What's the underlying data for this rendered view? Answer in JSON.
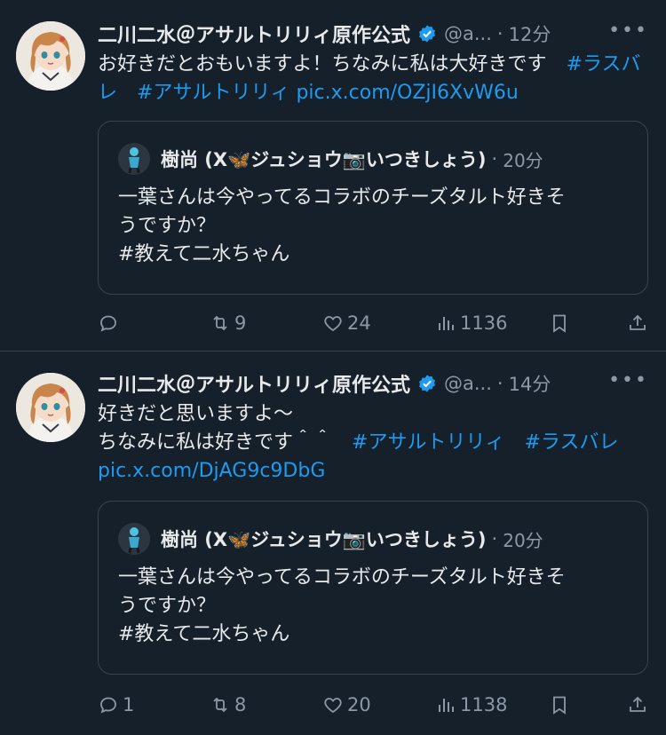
{
  "tweets": [
    {
      "author_name": "二川二水＠アサルトリリィ原作公式",
      "handle": "@a...",
      "separator": "·",
      "time": "12分",
      "text_plain": "お好きだとおもいますよ！ちなみに私は大好きです　",
      "hashtag1": "#ラスバレ",
      "hashtag2": "#アサルトリリィ",
      "link": "pic.x.com/OZjI6XvW6u",
      "quote": {
        "author": "樹尚 (X🦋ジュショウ📷いつきしょう)",
        "time": "20分",
        "line1": "一葉さんは今やってるコラボのチーズタルト好きそ",
        "line2": "うですか？",
        "line3": "#教えて二水ちゃん"
      },
      "replies": "",
      "retweets": "9",
      "likes": "24",
      "views": "1136"
    },
    {
      "author_name": "二川二水＠アサルトリリィ原作公式",
      "handle": "@a...",
      "separator": "·",
      "time": "14分",
      "line1": "好きだと思いますよ〜",
      "line2_plain": "ちなみに私は好きです＾＾　",
      "hashtag1": "#アサルトリリィ",
      "hashtag2": "#ラスバレ",
      "link": "pic.x.com/DjAG9c9DbG",
      "quote": {
        "author": "樹尚 (X🦋ジュショウ📷いつきしょう)",
        "time": "20分",
        "line1": "一葉さんは今やってるコラボのチーズタルト好きそ",
        "line2": "うですか？",
        "line3": "#教えて二水ちゃん"
      },
      "replies": "1",
      "retweets": "8",
      "likes": "20",
      "views": "1138"
    }
  ],
  "more_label": "•••",
  "colors": {
    "background": "#15202b",
    "accent": "#1d9bf0",
    "muted": "#8b98a5",
    "border": "#38444d"
  }
}
